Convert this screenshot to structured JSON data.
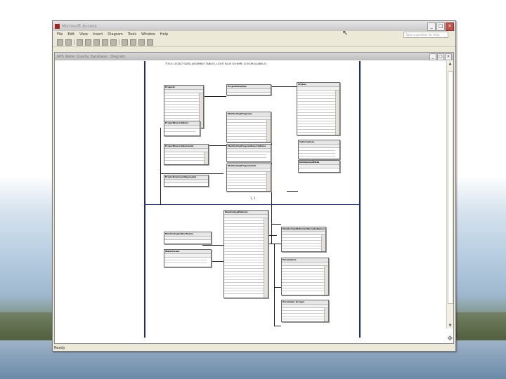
{
  "app": {
    "title": "Microsoft Access",
    "menu": [
      "File",
      "Edit",
      "View",
      "Insert",
      "Diagram",
      "Tools",
      "Window",
      "Help"
    ],
    "ask_placeholder": "Type a question for help",
    "status": "Ready"
  },
  "document": {
    "title": "NPS Water Quality Database : Diagram",
    "page_header": "TITLE: LEGACY DATA ASSEMBLY TABLES, LIGHT BLUE SCHEME (COLORS/LABELS)",
    "page_number": "1, 1"
  },
  "tables": [
    {
      "id": "t1",
      "name": "Projects"
    },
    {
      "id": "t2",
      "name": "ProjectAnalytes"
    },
    {
      "id": "t3",
      "name": "DataUploadMeta"
    },
    {
      "id": "t4",
      "name": "MonitoringPrograms"
    },
    {
      "id": "t5",
      "name": "ProjectDescriptions"
    },
    {
      "id": "t6",
      "name": "ProjectDescriptionsLink"
    },
    {
      "id": "t7",
      "name": "MonitoringProgramDescriptions"
    },
    {
      "id": "t8",
      "name": "Ctybes"
    },
    {
      "id": "t9",
      "name": "MonitoringProgramLink"
    },
    {
      "id": "t10",
      "name": "Cyberspaces"
    },
    {
      "id": "t11",
      "name": "ProjectCommunitypeoples"
    },
    {
      "id": "t12",
      "name": "MonitoringStations"
    },
    {
      "id": "t13",
      "name": "MonitoringStationsAlternateNames"
    },
    {
      "id": "t14",
      "name": "MonitoringActionTeams"
    },
    {
      "id": "t15",
      "name": "WaterCodes"
    },
    {
      "id": "t16",
      "name": "Parameters"
    },
    {
      "id": "t17",
      "name": "Parameter Groups"
    }
  ],
  "icons": {
    "app_icon": "access-icon",
    "cursor": "move-cursor-icon"
  }
}
